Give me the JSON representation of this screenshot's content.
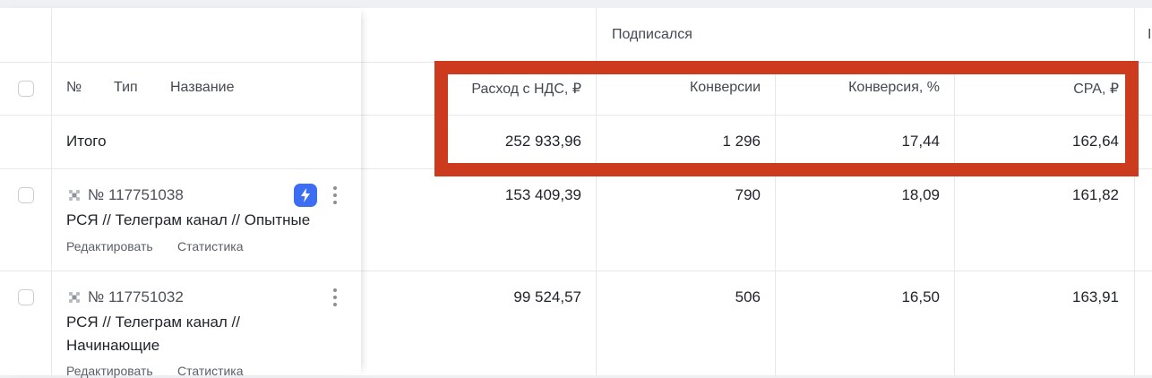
{
  "group_header": {
    "label": "Подписался",
    "next_label": "I"
  },
  "columns": {
    "number": "№",
    "type": "Тип",
    "name": "Название",
    "spend": "Расход с НДС, ₽",
    "conversions": "Конверсии",
    "conversion_rate": "Конверсия, %",
    "cpa": "CPA, ₽"
  },
  "total": {
    "label": "Итого",
    "spend": "252 933,96",
    "conversions": "1 296",
    "conversion_rate": "17,44",
    "cpa": "162,64"
  },
  "rows": [
    {
      "id": "№ 117751038",
      "name": "РСЯ // Телеграм канал // Опытные",
      "edit_link": "Редактировать",
      "stats_link": "Статистика",
      "spend": "153 409,39",
      "conversions": "790",
      "conversion_rate": "18,09",
      "cpa": "161,82",
      "has_autostrategy_badge": true
    },
    {
      "id": "№ 117751032",
      "name": "РСЯ // Телеграм канал // Начинающие",
      "edit_link": "Редактировать",
      "stats_link": "Статистика",
      "spend": "99 524,57",
      "conversions": "506",
      "conversion_rate": "16,50",
      "cpa": "163,91",
      "has_autostrategy_badge": false
    }
  ],
  "colors": {
    "highlight": "#cd3b1f",
    "badge": "#3d6df2"
  }
}
